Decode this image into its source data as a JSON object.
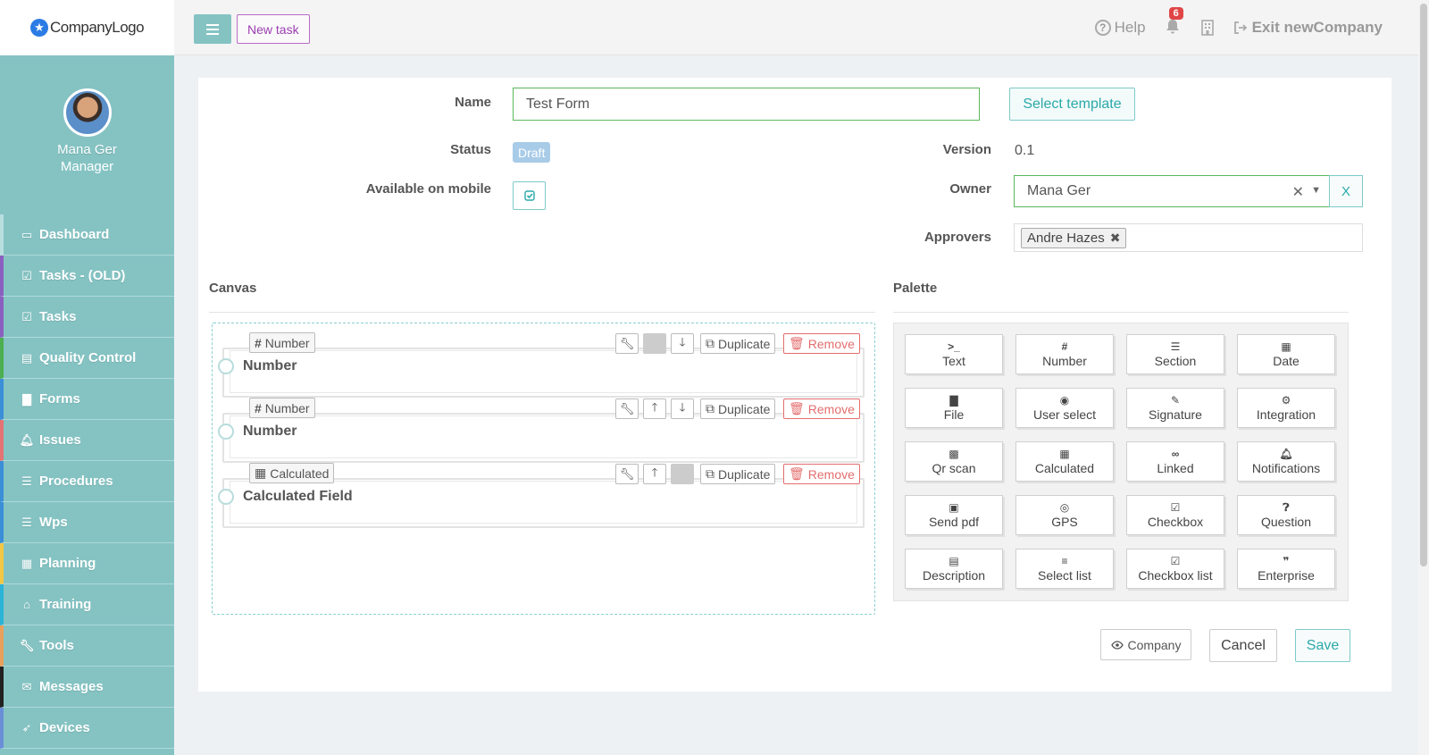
{
  "logo": {
    "text": "CompanyLogo"
  },
  "user": {
    "name": "Mana Ger",
    "role": "Manager"
  },
  "sidebar": {
    "items": [
      {
        "label": "Dashboard",
        "icon": "monitor-icon",
        "color": "#b9dede"
      },
      {
        "label": "Tasks - (OLD)",
        "icon": "check-square-icon",
        "color": "#8b5fc0"
      },
      {
        "label": "Tasks",
        "icon": "check-square-icon",
        "color": "#8b5fc0"
      },
      {
        "label": "Quality Control",
        "icon": "book-icon",
        "color": "#4caf50"
      },
      {
        "label": "Forms",
        "icon": "file-icon",
        "color": "#3b8fd8"
      },
      {
        "label": "Issues",
        "icon": "bell-icon",
        "color": "#e57373"
      },
      {
        "label": "Procedures",
        "icon": "list-icon",
        "color": "#3b8fd8"
      },
      {
        "label": "Wps",
        "icon": "list-icon",
        "color": "#3b8fd8"
      },
      {
        "label": "Planning",
        "icon": "calendar-icon",
        "color": "#f2c744"
      },
      {
        "label": "Training",
        "icon": "graduation-cap-icon",
        "color": "#2bb3d8"
      },
      {
        "label": "Tools",
        "icon": "wrench-icon",
        "color": "#e8a05c"
      },
      {
        "label": "Messages",
        "icon": "envelope-icon",
        "color": "#222222"
      },
      {
        "label": "Devices",
        "icon": "rocket-icon",
        "color": "#6a8fd8"
      }
    ]
  },
  "topbar": {
    "new_task": "New task",
    "help": "Help",
    "notifications_count": "6",
    "exit": "Exit newCompany"
  },
  "form": {
    "name_label": "Name",
    "name_value": "Test Form",
    "select_template": "Select template",
    "status_label": "Status",
    "status_value": "Draft",
    "version_label": "Version",
    "version_value": "0.1",
    "mobile_label": "Available on mobile",
    "mobile_checked": true,
    "owner_label": "Owner",
    "owner_value": "Mana Ger",
    "owner_clear": "X",
    "approvers_label": "Approvers",
    "approvers": [
      "Andre Hazes"
    ]
  },
  "canvas": {
    "title": "Canvas",
    "fields": [
      {
        "type": "Number",
        "type_icon": "hash-icon",
        "label": "Number",
        "up_enabled": false,
        "down_enabled": true
      },
      {
        "type": "Number",
        "type_icon": "hash-icon",
        "label": "Number",
        "up_enabled": true,
        "down_enabled": true
      },
      {
        "type": "Calculated",
        "type_icon": "calculator-icon",
        "label": "Calculated Field",
        "up_enabled": true,
        "down_enabled": false
      }
    ],
    "duplicate_label": "Duplicate",
    "remove_label": "Remove"
  },
  "palette": {
    "title": "Palette",
    "items": [
      {
        "label": "Text",
        "icon": "terminal-icon"
      },
      {
        "label": "Number",
        "icon": "hash-icon"
      },
      {
        "label": "Section",
        "icon": "section-icon"
      },
      {
        "label": "Date",
        "icon": "calendar-icon"
      },
      {
        "label": "File",
        "icon": "file-icon"
      },
      {
        "label": "User select",
        "icon": "user-circle-icon"
      },
      {
        "label": "Signature",
        "icon": "signature-icon"
      },
      {
        "label": "Integration",
        "icon": "gears-icon"
      },
      {
        "label": "Qr scan",
        "icon": "qrcode-icon"
      },
      {
        "label": "Calculated",
        "icon": "calculator-icon"
      },
      {
        "label": "Linked",
        "icon": "link-icon"
      },
      {
        "label": "Notifications",
        "icon": "bell-icon"
      },
      {
        "label": "Send pdf",
        "icon": "picture-icon"
      },
      {
        "label": "GPS",
        "icon": "target-icon"
      },
      {
        "label": "Checkbox",
        "icon": "check-square-icon"
      },
      {
        "label": "Question",
        "icon": "question-circle-icon"
      },
      {
        "label": "Description",
        "icon": "file-text-icon"
      },
      {
        "label": "Select list",
        "icon": "list-ol-icon"
      },
      {
        "label": "Checkbox list",
        "icon": "check-square-icon"
      },
      {
        "label": "Enterprise",
        "icon": "quote-icon"
      }
    ]
  },
  "actions": {
    "company": "Company",
    "cancel": "Cancel",
    "save": "Save"
  },
  "colors": {
    "sidebar_bg": "#85c3c3",
    "accent": "#2aa9a9",
    "success_border": "#5cb85c",
    "danger": "#e46e6e",
    "new_task": "#9b3fb0"
  }
}
